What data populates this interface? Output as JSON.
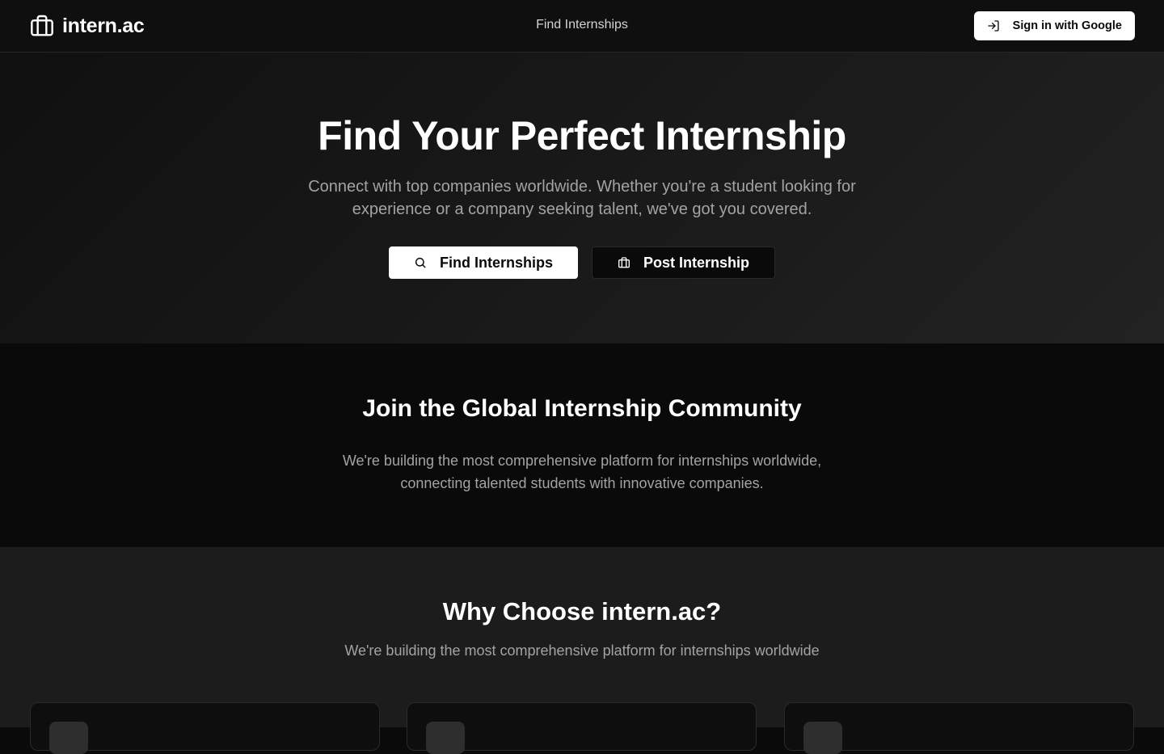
{
  "header": {
    "brand": "intern.ac",
    "nav_link": "Find Internships",
    "signin_label": "Sign in with Google"
  },
  "hero": {
    "title": "Find Your Perfect Internship",
    "subtitle": "Connect with top companies worldwide. Whether you're a student looking for experience or a company seeking talent, we've got you covered.",
    "primary_label": "Find Internships",
    "secondary_label": "Post Internship"
  },
  "community": {
    "title": "Join the Global Internship Community",
    "subtitle": "We're building the most comprehensive platform for internships worldwide, connecting talented students with innovative companies."
  },
  "why": {
    "title": "Why Choose intern.ac?",
    "subtitle": "We're building the most comprehensive platform for internships worldwide"
  },
  "icons": {
    "brand": "briefcase-icon",
    "signin": "log-in-icon",
    "search": "search-icon",
    "post": "briefcase-icon"
  },
  "colors": {
    "background": "#0a0a0a",
    "primary_button": "#ffffff",
    "muted_text": "#a3a3a3"
  }
}
